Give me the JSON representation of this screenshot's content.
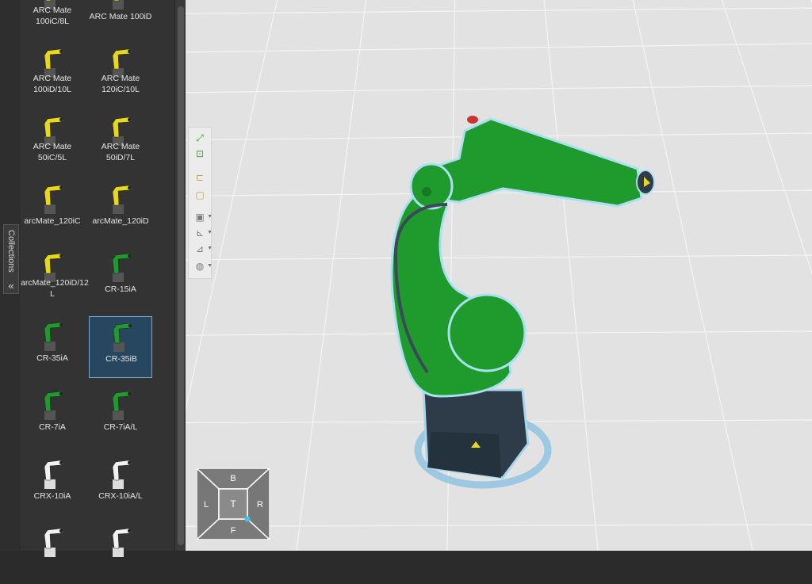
{
  "collections_tab": {
    "label": "Collections",
    "collapse_icon": "double-chevron-left-icon"
  },
  "library": {
    "selected": "CR-35iB",
    "items": [
      {
        "name": "ARC Mate\n100iC/8L",
        "color": "#e8d81c"
      },
      {
        "name": "ARC Mate 100iD",
        "color": "#e8d81c"
      },
      {
        "name": "ARC Mate\n100iD/10L",
        "color": "#e8d81c"
      },
      {
        "name": "ARC Mate\n120iC/10L",
        "color": "#e8d81c"
      },
      {
        "name": "ARC Mate\n50iC/5L",
        "color": "#e8d81c"
      },
      {
        "name": "ARC Mate\n50iD/7L",
        "color": "#e8d81c"
      },
      {
        "name": "arcMate_120iC",
        "color": "#e8d81c"
      },
      {
        "name": "arcMate_120iD",
        "color": "#e8d81c"
      },
      {
        "name": "arcMate_120iD/12\nL",
        "color": "#e8d81c"
      },
      {
        "name": "CR-15iA",
        "color": "#1f9a2c"
      },
      {
        "name": "CR-35iA",
        "color": "#1f9a2c"
      },
      {
        "name": "CR-35iB",
        "color": "#1f9a2c"
      },
      {
        "name": "CR-7iA",
        "color": "#1f9a2c"
      },
      {
        "name": "CR-7iA/L",
        "color": "#1f9a2c"
      },
      {
        "name": "CRX-10iA",
        "color": "#f2f2f2"
      },
      {
        "name": "CRX-10iA/L",
        "color": "#f2f2f2"
      },
      {
        "name": "",
        "color": "#f2f2f2"
      },
      {
        "name": "",
        "color": "#f2f2f2"
      }
    ]
  },
  "view_toolbar": [
    {
      "icon": "fit-all-icon"
    },
    {
      "icon": "fit-selection-icon"
    },
    {
      "icon": "snap-icon"
    },
    {
      "icon": "wireframe-cube-icon"
    },
    {
      "icon": "shaded-cube-icon"
    },
    {
      "icon": "axes-icon"
    },
    {
      "icon": "coordinate-frame-icon"
    },
    {
      "icon": "display-options-icon"
    }
  ],
  "nav_cube": {
    "top": "B",
    "left": "L",
    "center": "T",
    "right": "R",
    "bottom": "F"
  },
  "colors": {
    "robot_green": "#1f9a2c",
    "robot_base": "#2d3c48",
    "selection_ring": "#8fc3e2",
    "panel_bg": "#333333",
    "viewport_bg": "#e2e2e2"
  }
}
